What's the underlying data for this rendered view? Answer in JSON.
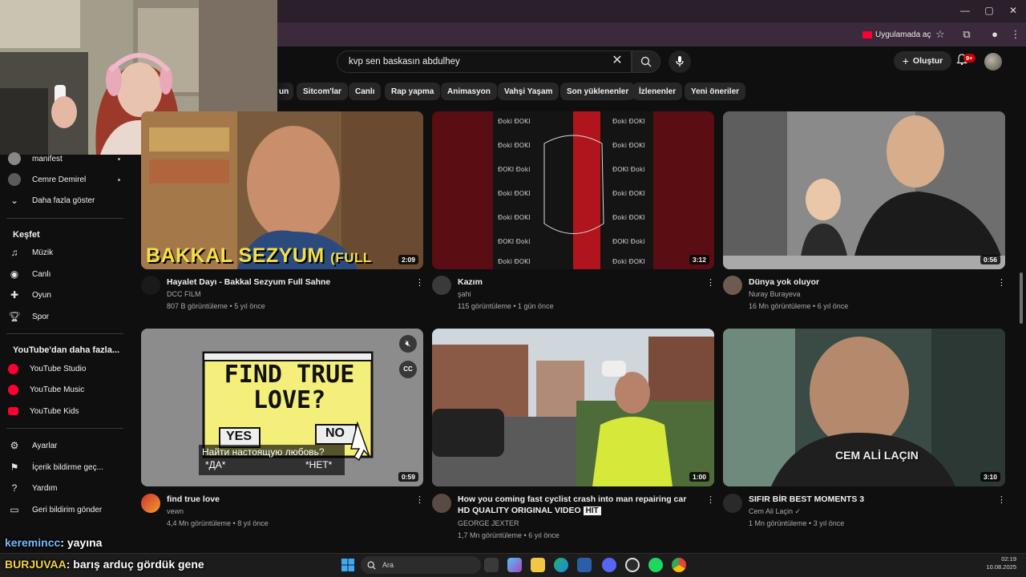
{
  "browser": {
    "open_in_app": "Uygulamada aç"
  },
  "search": {
    "query": "kvp sen baskasın abdulhey"
  },
  "header": {
    "create_label": "Oluştur",
    "notifications_badge": "9+"
  },
  "chips": [
    "un",
    "Sitcom'lar",
    "Canlı",
    "Rap yapma",
    "Animasyon",
    "Vahşi Yaşam",
    "Son yüklenenler",
    "İzlenenler",
    "Yeni öneriler"
  ],
  "sidebar": {
    "subs": [
      {
        "label": "manifest"
      },
      {
        "label": "Cemre Demirel"
      },
      {
        "label": "Daha fazla göster",
        "icon": "chevron-down-icon"
      }
    ],
    "explore_title": "Keşfet",
    "explore": [
      {
        "label": "Müzik",
        "icon": "music-icon"
      },
      {
        "label": "Canlı",
        "icon": "live-icon"
      },
      {
        "label": "Oyun",
        "icon": "gamepad-icon"
      },
      {
        "label": "Spor",
        "icon": "trophy-icon"
      }
    ],
    "more_title": "YouTube'dan daha fazla...",
    "more": [
      {
        "label": "YouTube Studio"
      },
      {
        "label": "YouTube Music"
      },
      {
        "label": "YouTube Kids"
      }
    ],
    "settings": [
      {
        "label": "Ayarlar",
        "icon": "gear-icon"
      },
      {
        "label": "İçerik bildirme geç...",
        "icon": "flag-icon"
      },
      {
        "label": "Yardım",
        "icon": "help-icon"
      },
      {
        "label": "Geri bildirim gönder",
        "icon": "feedback-icon"
      }
    ]
  },
  "videos": [
    {
      "title": "Hayalet Dayı - Bakkal Sezyum Full Sahne",
      "channel": "DCC FILM",
      "meta": "807 B görüntüleme • 5 yıl önce",
      "duration": "2:09",
      "thumb_text": "BAKKAL SEZYUM",
      "thumb_sub": "(FULL SAHNE)"
    },
    {
      "title": "Kazım",
      "channel": "şahi",
      "meta": "115 görüntüleme • 1 gün önce",
      "duration": "3:12"
    },
    {
      "title": "Dünya yok oluyor",
      "channel": "Nuray Burayeva",
      "meta": "16 Mn görüntüleme • 6 yıl önce",
      "duration": "0:56"
    },
    {
      "title": "find true love",
      "channel": "vewn",
      "meta": "4,4 Mn görüntüleme • 8 yıl önce",
      "duration": "0:59",
      "thumb_text": "FIND TRUE LOVE?",
      "yes": "YES",
      "no": "NO",
      "subtitle1": "Найти настоящую любовь?",
      "subtitle2": "*ДА*",
      "subtitle3": "*НЕТ*"
    },
    {
      "title": "How you coming fast cyclist crash into man repairing car HD QUALITY ORIGINAL VIDEO",
      "title_tag": "HIT",
      "channel": "GEORGE JEXTER",
      "meta": "1,7 Mn görüntüleme • 6 yıl önce",
      "duration": "1:00"
    },
    {
      "title": "SIFIR BİR BEST MOMENTS 3",
      "channel": "Cem Ali Laçin ✓",
      "meta": "1 Mn görüntüleme • 3 yıl önce",
      "duration": "3:10",
      "thumb_text": "CEM ALİ LAÇIN"
    }
  ],
  "overlay": {
    "chat1_user": "keremincc",
    "chat1_msg": ": yayına",
    "chat2_user": "BURJUVAA",
    "chat2_msg": ": barış arduç gördük gene"
  },
  "taskbar": {
    "search_placeholder": "Ara",
    "time": "02:19",
    "date": "10.08.2025"
  },
  "colors": {
    "background": "#0f0f0f",
    "accent": "#ff0033",
    "chip": "#272727"
  }
}
